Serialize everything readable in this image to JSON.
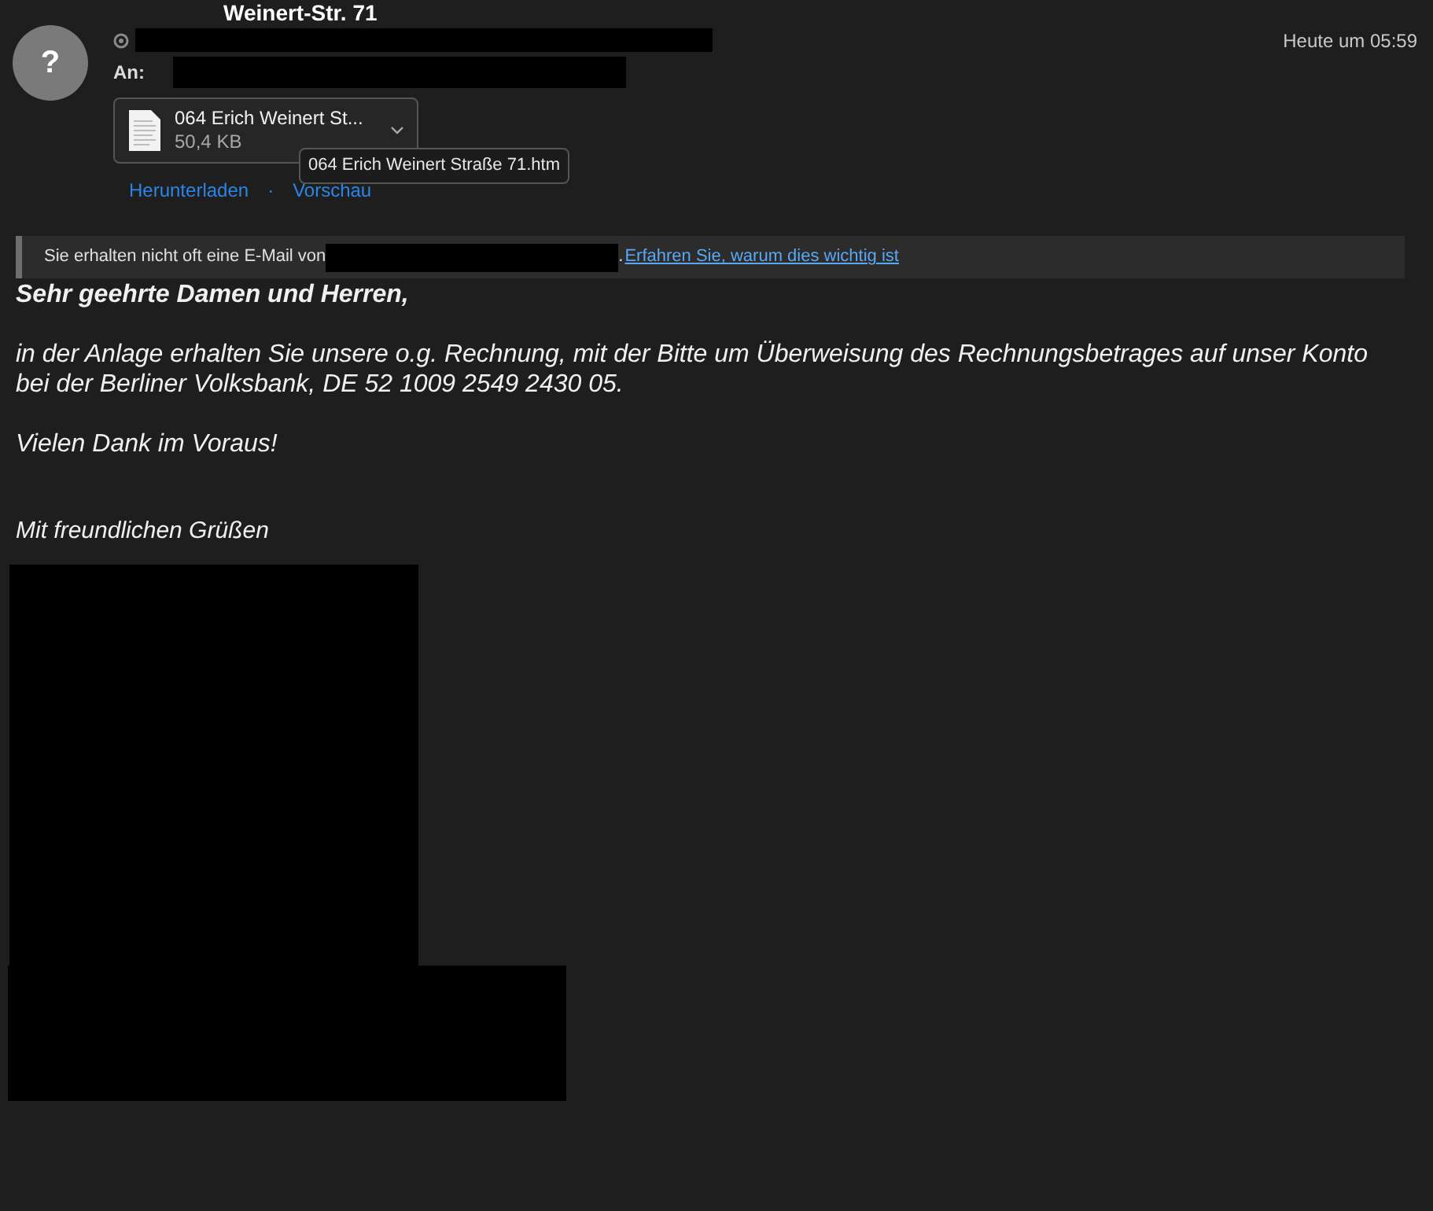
{
  "header": {
    "subject": "Weinert-Str. 71",
    "avatar": "?",
    "to_label": "An:",
    "date": "Heute um 05:59"
  },
  "attachment": {
    "name": "064 Erich Weinert St...",
    "size": "50,4 KB",
    "tooltip": "064 Erich Weinert Straße 71.htm"
  },
  "attachment_actions": [
    "Herunterladen",
    "·",
    "Vorschau"
  ],
  "notice": {
    "text": "Sie erhalten nicht oft eine E-Mail von",
    "after": ".",
    "link": "Erfahren Sie, warum dies wichtig ist"
  },
  "body": [
    {
      "kind": "greeting",
      "text": "Sehr geehrte Damen und Herren,"
    },
    {
      "kind": "paragraph",
      "text": "in der Anlage erhalten Sie unsere o.g. Rechnung, mit der Bitte um Überweisung des Rechnungsbetrages auf unser Konto bei der Berliner Volksbank, DE 52 1009 2549 2430 05."
    },
    {
      "kind": "paragraph",
      "text": "Vielen Dank im Voraus!"
    },
    {
      "kind": "closing",
      "text": "Mit freundlichen Grüßen"
    }
  ]
}
